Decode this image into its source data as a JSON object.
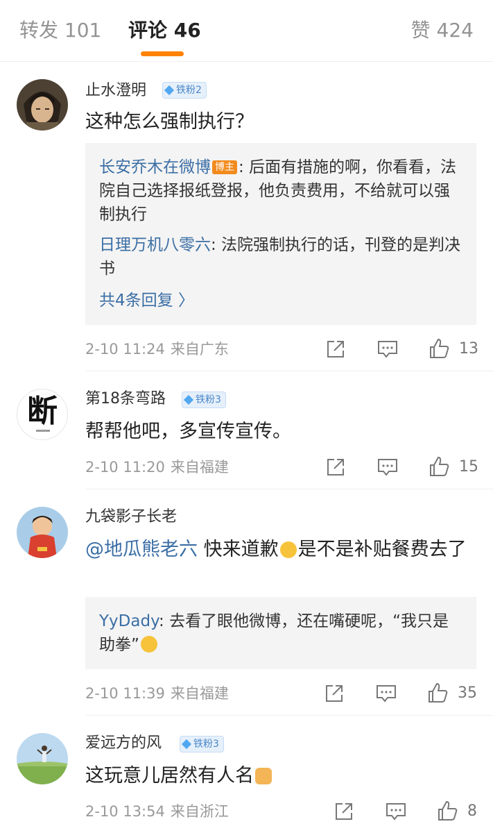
{
  "tabs": {
    "repost": "转发 101",
    "comments": "评论 46",
    "likes": "赞 424"
  },
  "colors": {
    "accent": "#ff8200",
    "link": "#3b6ea5",
    "meta": "#999999"
  },
  "comments": [
    {
      "user": "止水澄明",
      "badge": "铁粉2",
      "text": "这种怎么强制执行？",
      "replies": [
        {
          "name": "长安乔木在微博",
          "tag": "博主",
          "text": ": 后面有措施的啊，你看看，法院自己选择报纸登报，他负责费用，不给就可以强制执行"
        },
        {
          "name": "日理万机八零六",
          "text": ": 法院强制执行的话，刊登的是判决书"
        }
      ],
      "more_replies": "共4条回复 〉",
      "time": "2-10 11:24",
      "location": "来自广东",
      "likes": "13"
    },
    {
      "user": "第18条弯路",
      "badge": "铁粉3",
      "text": "帮帮他吧，多宣传宣传。",
      "avatar_text": "断",
      "time": "2-10 11:20",
      "location": "来自福建",
      "likes": "15"
    },
    {
      "user": "九袋影子长老",
      "mention": "@地瓜熊老六",
      "text_a": " 快来道歉",
      "text_b": "是不是补贴餐费去了",
      "replies": [
        {
          "name": "YyDady",
          "text": ": 去看了眼他微博，还在嘴硬呢，“我只是助拳”"
        }
      ],
      "time": "2-10 11:39",
      "location": "来自福建",
      "likes": "35"
    },
    {
      "user": "爱远方的风",
      "badge": "铁粉3",
      "text": "这玩意儿居然有人名",
      "time": "2-10 13:54",
      "location": "来自浙江",
      "likes": "8"
    }
  ]
}
